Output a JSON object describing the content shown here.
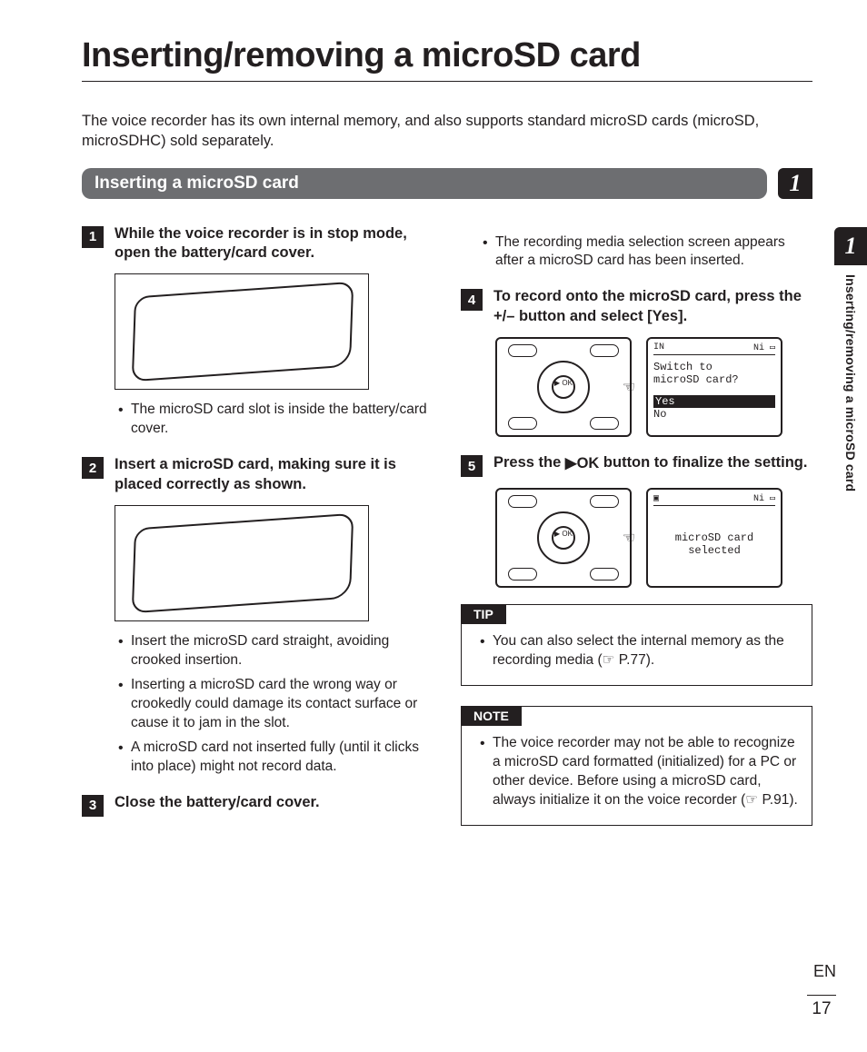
{
  "title": "Inserting/removing a microSD card",
  "intro": "The voice recorder has its own internal memory, and also supports standard microSD cards (microSD, microSDHC) sold separately.",
  "section_heading": "Inserting a microSD card",
  "chapter_number": "1",
  "steps": {
    "s1": {
      "num": "1",
      "text": "While the voice recorder is in stop mode, open the battery/card cover."
    },
    "s1_bullets": [
      "The microSD card slot is inside the battery/card cover."
    ],
    "s2": {
      "num": "2",
      "text": "Insert a microSD card, making sure it is placed correctly as shown."
    },
    "s2_bullets": [
      "Insert the microSD card straight, avoiding crooked insertion.",
      "Inserting a microSD card the wrong way or crookedly could damage its contact surface or cause it to jam in the slot.",
      "A microSD card not inserted fully (until it clicks into place) might not record data."
    ],
    "s3": {
      "num": "3",
      "text": "Close the battery/card cover."
    },
    "s3_bullets": [
      "The recording media selection screen appears after a microSD card has been inserted."
    ],
    "s4": {
      "num": "4",
      "text_pre": "To record onto the microSD card, press the +/– button and select [",
      "yes": "Yes",
      "text_post": "]."
    },
    "s5": {
      "num": "5",
      "text_pre": "Press the ",
      "ok": "▶OK",
      "text_post": " button to finalize the setting."
    }
  },
  "lcd": {
    "switch": {
      "badge_left": "IN",
      "badge_right": "Ni",
      "line1": "Switch to",
      "line2": "microSD card?",
      "opt_yes": "Yes",
      "opt_no": "No"
    },
    "selected": {
      "badge_right": "Ni",
      "line1": "microSD card",
      "line2": "selected"
    },
    "ok_label": "▶\nOK"
  },
  "tip": {
    "label": "TIP",
    "text": "You can also select the internal memory as the recording media (☞ P.77)."
  },
  "note": {
    "label": "NOTE",
    "text": "The voice recorder may not be able to recognize a microSD card formatted (initialized) for a PC or other device. Before using a microSD card, always initialize it on the voice recorder (☞ P.91)."
  },
  "side": {
    "chapter": "1",
    "title": "Inserting/removing a microSD card"
  },
  "footer": {
    "lang": "EN",
    "page": "17"
  }
}
